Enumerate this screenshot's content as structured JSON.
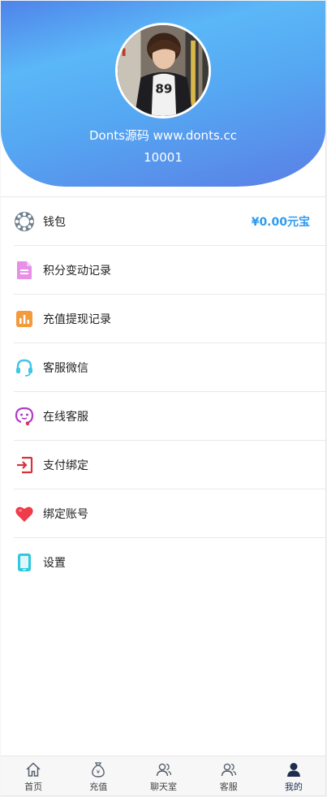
{
  "profile": {
    "username": "Donts源码 www.donts.cc",
    "user_id": "10001"
  },
  "menu": [
    {
      "label": "钱包",
      "value": "¥0.00元宝",
      "icon": "wallet-icon"
    },
    {
      "label": "积分变动记录",
      "icon": "points-record-icon"
    },
    {
      "label": "充值提现记录",
      "icon": "recharge-record-icon"
    },
    {
      "label": "客服微信",
      "icon": "headset-icon"
    },
    {
      "label": "在线客服",
      "icon": "online-service-icon"
    },
    {
      "label": "支付绑定",
      "icon": "payment-bind-icon"
    },
    {
      "label": "绑定账号",
      "icon": "heart-icon"
    },
    {
      "label": "设置",
      "icon": "phone-icon"
    }
  ],
  "tabbar": [
    {
      "label": "首页",
      "icon": "home-icon"
    },
    {
      "label": "充值",
      "icon": "money-bag-icon"
    },
    {
      "label": "聊天室",
      "icon": "chat-users-icon"
    },
    {
      "label": "客服",
      "icon": "service-users-icon"
    },
    {
      "label": "我的",
      "icon": "user-icon",
      "active": true
    }
  ],
  "colors": {
    "accent": "#2f9bef",
    "header_gradient": [
      "#4f83ea",
      "#5bb7f7",
      "#5a7fe5"
    ]
  }
}
